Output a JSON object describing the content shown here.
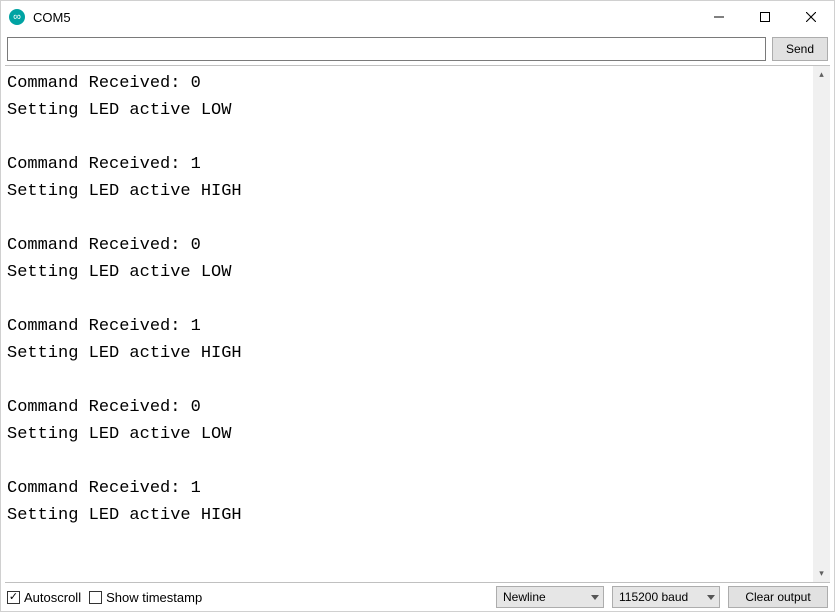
{
  "window": {
    "title": "COM5"
  },
  "input": {
    "value": "",
    "send_label": "Send"
  },
  "console": {
    "lines": [
      "Command Received: 0",
      "Setting LED active LOW",
      "",
      "Command Received: 1",
      "Setting LED active HIGH",
      "",
      "Command Received: 0",
      "Setting LED active LOW",
      "",
      "Command Received: 1",
      "Setting LED active HIGH",
      "",
      "Command Received: 0",
      "Setting LED active LOW",
      "",
      "Command Received: 1",
      "Setting LED active HIGH",
      ""
    ]
  },
  "bottom": {
    "autoscroll": {
      "label": "Autoscroll",
      "checked": true
    },
    "timestamp": {
      "label": "Show timestamp",
      "checked": false
    },
    "line_ending": {
      "selected": "Newline"
    },
    "baud": {
      "selected": "115200 baud"
    },
    "clear_label": "Clear output"
  },
  "icons": {
    "minimize": "minimize-icon",
    "maximize": "maximize-icon",
    "close": "close-icon",
    "app": "arduino-icon",
    "scroll_up": "▴",
    "scroll_down": "▾"
  }
}
